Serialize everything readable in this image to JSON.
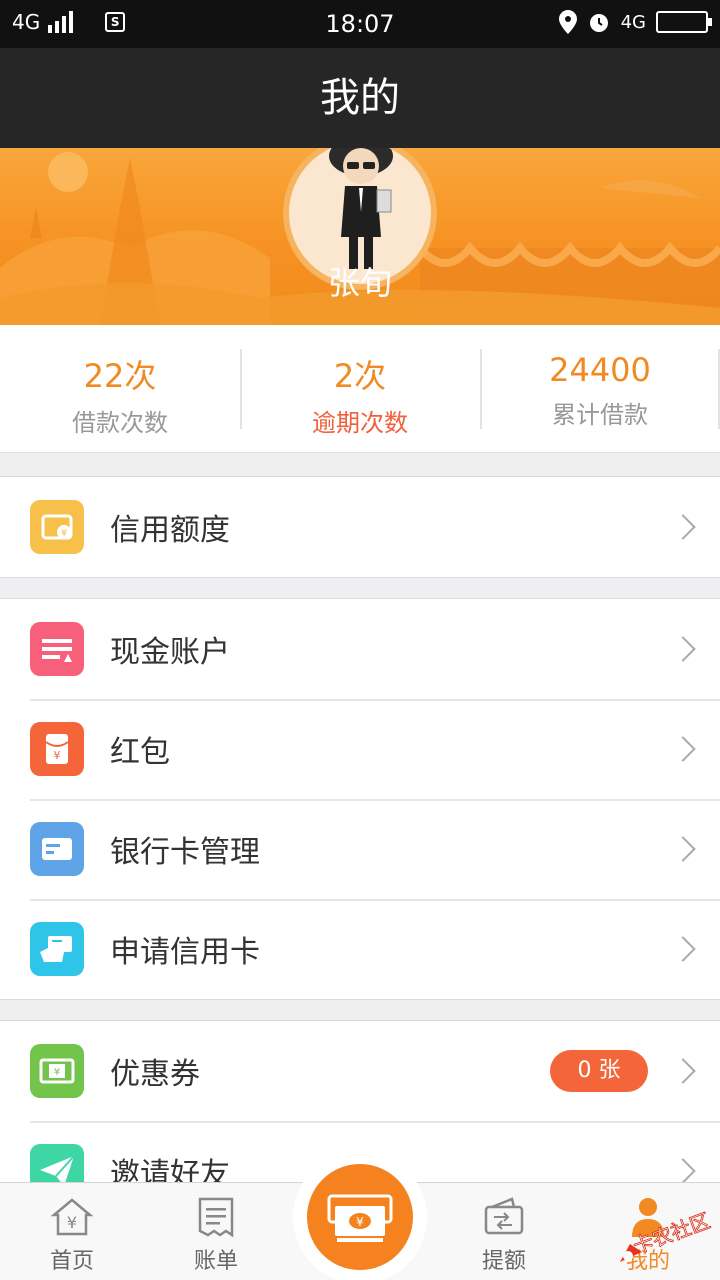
{
  "status_bar": {
    "network_left": "4G",
    "time": "18:07",
    "network_right": "4G",
    "sim_icon": "S"
  },
  "title": "我的",
  "profile": {
    "name": "张旬"
  },
  "stats": [
    {
      "value": "22次",
      "label": "借款次数"
    },
    {
      "value": "2次",
      "label": "逾期次数"
    },
    {
      "value": "24400",
      "label": "累计借款"
    }
  ],
  "menu": {
    "credit_limit": "信用额度",
    "cash_account": "现金账户",
    "red_packet": "红包",
    "bank_card": "银行卡管理",
    "apply_card": "申请信用卡",
    "coupons": "优惠券",
    "coupons_badge": "0 张",
    "invite": "邀请好友"
  },
  "tabs": {
    "home": "首页",
    "bill": "账单",
    "withdraw": "提额",
    "mine": "我的"
  },
  "watermark": "卡农社区",
  "colors": {
    "accent": "#f18a22",
    "warn": "#f0603a",
    "badge": "#f4663a"
  }
}
